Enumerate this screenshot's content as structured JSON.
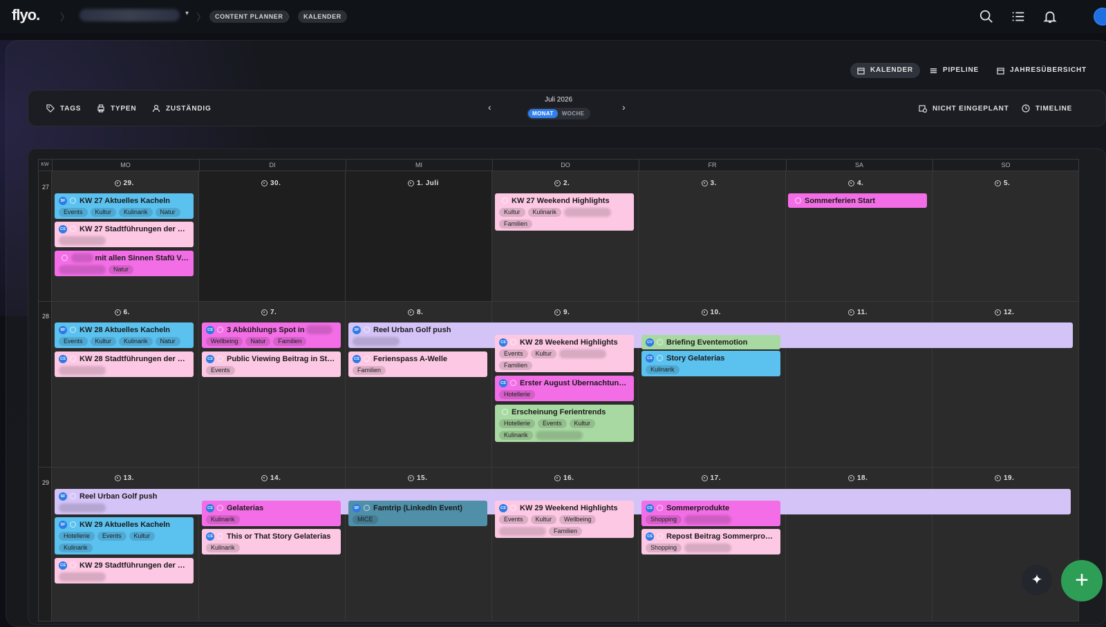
{
  "topbar": {
    "logo": "flyo.",
    "crumbs": [
      "CONTENT PLANNER",
      "KALENDER"
    ]
  },
  "views": {
    "kalender": "KALENDER",
    "pipeline": "PIPELINE",
    "jahr": "JAHRESÜBERSICHT"
  },
  "toolbar": {
    "tags": "TAGS",
    "typen": "TYPEN",
    "zustaendig": "ZUSTÄNDIG",
    "month": "Juli 2026",
    "monat": "MONAT",
    "woche": "WOCHE",
    "nicht": "NICHT EINGEPLANT",
    "timeline": "TIMELINE"
  },
  "weekdays": [
    "MO",
    "DI",
    "MI",
    "DO",
    "FR",
    "SA",
    "SO"
  ],
  "kw_label": "KW",
  "weeks": [
    {
      "kw": "27",
      "days": [
        "29.",
        "30.",
        "1. Juli",
        "2.",
        "3.",
        "4.",
        "5."
      ]
    },
    {
      "kw": "28",
      "days": [
        "6.",
        "7.",
        "8.",
        "9.",
        "10.",
        "11.",
        "12."
      ]
    },
    {
      "kw": "29",
      "days": [
        "13.",
        "14.",
        "15.",
        "16.",
        "17.",
        "18.",
        "19."
      ]
    }
  ],
  "cards": [
    {
      "title": "KW 27 Aktuelles Kacheln",
      "badge": "SF",
      "tags": [
        "Events",
        "Kultur",
        "Kulinarik",
        "Natur"
      ]
    },
    {
      "title": "KW 27 Stadtführungen der Wo...",
      "badge": "CS",
      "tags": []
    },
    {
      "title": "mit allen Sinnen Stafü Vor...",
      "badge": "",
      "tags": [
        "Natur"
      ]
    },
    {
      "title": "KW 27 Weekend Highlights",
      "badge": "",
      "tags": [
        "Kultur",
        "Kulinarik",
        "Familien"
      ]
    },
    {
      "title": "Sommerferien Start",
      "badge": "",
      "tags": []
    },
    {
      "title": "KW 28 Aktuelles Kacheln",
      "badge": "SF",
      "tags": [
        "Events",
        "Kultur",
        "Kulinarik",
        "Natur"
      ]
    },
    {
      "title": "KW 28 Stadtführungen der Wo...",
      "badge": "CS",
      "tags": []
    },
    {
      "title": "3 Abkühlungs Spot in",
      "badge": "CS",
      "tags": [
        "Wellbeing",
        "Natur",
        "Familien"
      ]
    },
    {
      "title": "Public Viewing Beitrag in Stor...",
      "badge": "CS",
      "tags": [
        "Events"
      ]
    },
    {
      "title": "Reel Urban Golf push",
      "badge": "SF",
      "tags": []
    },
    {
      "title": "Ferienspass A-Welle",
      "badge": "CS",
      "tags": [
        "Familien"
      ]
    },
    {
      "title": "KW 28 Weekend Highlights",
      "badge": "CS",
      "tags": [
        "Events",
        "Kultur",
        "Familien"
      ]
    },
    {
      "title": "Erster August Übernachtungs...",
      "badge": "CS",
      "tags": [
        "Hotellerie"
      ]
    },
    {
      "title": "Erscheinung Ferientrends",
      "badge": "",
      "tags": [
        "Hotellerie",
        "Events",
        "Kultur",
        "Kulinarik"
      ]
    },
    {
      "title": "Briefing Eventemotion",
      "badge": "CV",
      "tags": []
    },
    {
      "title": "Story Gelaterias",
      "badge": "CS",
      "tags": [
        "Kulinarik"
      ]
    },
    {
      "title": "Reel Urban Golf push",
      "badge": "SF",
      "tags": []
    },
    {
      "title": "KW 29 Aktuelles Kacheln",
      "badge": "SF",
      "tags": [
        "Hotellerie",
        "Events",
        "Kultur",
        "Kulinarik"
      ]
    },
    {
      "title": "KW 29 Stadtführungen der Wo...",
      "badge": "CS",
      "tags": []
    },
    {
      "title": "Gelaterias",
      "badge": "CS",
      "tags": [
        "Kulinarik"
      ]
    },
    {
      "title": "This or That Story Gelaterias",
      "badge": "CS",
      "tags": [
        "Kulinarik"
      ]
    },
    {
      "title": "Famtrip (LinkedIn Event)",
      "badge": "SF",
      "tags": [
        "MICE"
      ]
    },
    {
      "title": "KW 29 Weekend Highlights",
      "badge": "CS",
      "tags": [
        "Events",
        "Kultur",
        "Wellbeing",
        "Familien"
      ]
    },
    {
      "title": "Sommerprodukte",
      "badge": "CS",
      "tags": [
        "Shopping"
      ]
    },
    {
      "title": "Repost Beitrag Sommerprodu...",
      "badge": "CS",
      "tags": [
        "Shopping"
      ]
    }
  ],
  "colors": {
    "blue": "#5bc2f0",
    "pink": "#fdc8e4",
    "magenta": "#f36ee6",
    "lavender": "#d4c3f7",
    "green": "#a9d9a2",
    "teal": "#4f8fa8",
    "fab": "#2e9e56"
  }
}
